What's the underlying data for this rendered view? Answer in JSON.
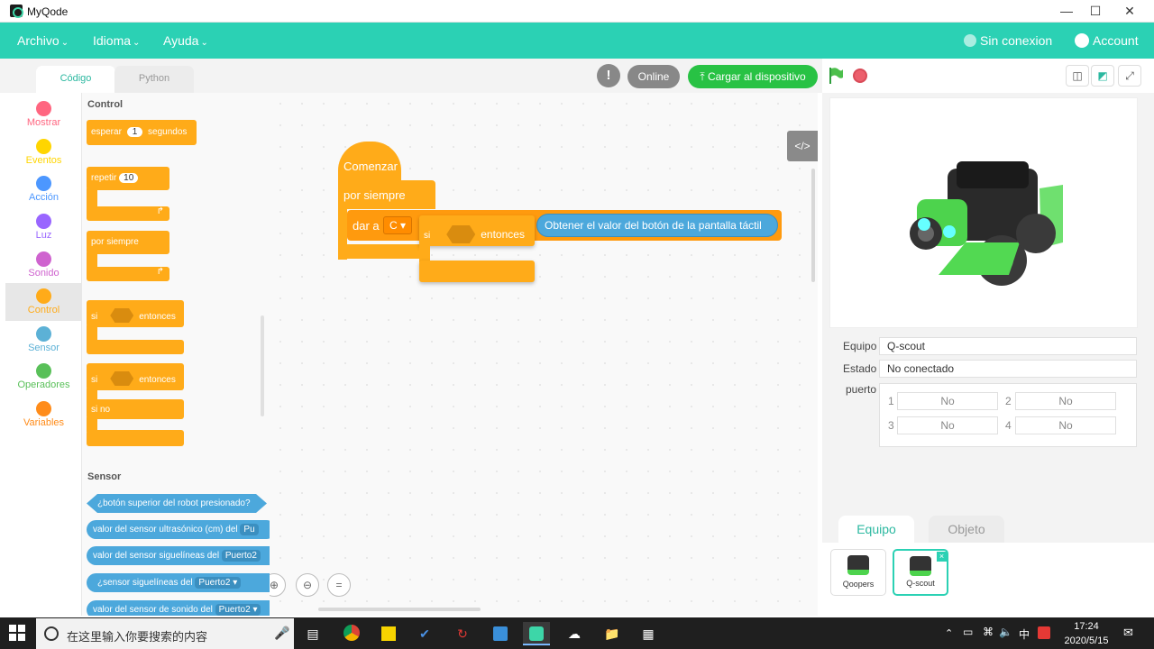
{
  "window": {
    "title": "MyQode"
  },
  "menu": {
    "archivo": "Archivo",
    "idioma": "Idioma",
    "ayuda": "Ayuda",
    "connection": "Sin conexion",
    "account": "Account"
  },
  "editor_tabs": {
    "codigo": "Código",
    "python": "Python"
  },
  "toolbar": {
    "online": "Online",
    "upload": "Cargar al dispositivo",
    "upload_icon": "⤒"
  },
  "categories": [
    {
      "label": "Mostrar",
      "color": "#ff6680"
    },
    {
      "label": "Eventos",
      "color": "#ffd500"
    },
    {
      "label": "Acción",
      "color": "#4c97ff"
    },
    {
      "label": "Luz",
      "color": "#9966ff"
    },
    {
      "label": "Sonido",
      "color": "#cf63cf"
    },
    {
      "label": "Control",
      "color": "#ffab19"
    },
    {
      "label": "Sensor",
      "color": "#5cb1d6"
    },
    {
      "label": "Operadores",
      "color": "#59c059"
    },
    {
      "label": "Variables",
      "color": "#ff8c1a"
    }
  ],
  "palette": {
    "control_heading": "Control",
    "wait": {
      "label": "esperar",
      "value": "1",
      "unit": "segundos"
    },
    "repeat": {
      "label": "repetir",
      "value": "10"
    },
    "forever": "por siempre",
    "if1": {
      "si": "si",
      "entonces": "entonces"
    },
    "if2": {
      "si": "si",
      "entonces": "entonces",
      "sino": "si no"
    },
    "sensor_heading": "Sensor",
    "sensor_blocks": [
      "¿botón superior del robot presionado?",
      "valor del sensor ultrasónico (cm) del",
      "valor del sensor siguelíneas del",
      "¿sensor siguelíneas del",
      "valor del sensor de sonido del"
    ],
    "sensor_ports": [
      "Pu",
      "Puerto2",
      "Puerto2 ▾",
      "Puerto2 ▾"
    ]
  },
  "workspace": {
    "start": "Comenzar",
    "forever": "por siempre",
    "set": "dar a",
    "var": "C ▾",
    "reporter": "Obtener el valor del botón de la pantalla táctil",
    "drag_if": {
      "si": "si",
      "entonces": "entonces"
    }
  },
  "device": {
    "equipo_label": "Equipo",
    "equipo_value": "Q-scout",
    "estado_label": "Estado",
    "estado_value": "No conectado",
    "puerto_label": "puerto",
    "ports": [
      {
        "n": "1",
        "v": "No"
      },
      {
        "n": "2",
        "v": "No"
      },
      {
        "n": "3",
        "v": "No"
      },
      {
        "n": "4",
        "v": "No"
      }
    ]
  },
  "bottom_tabs": {
    "equipo": "Equipo",
    "objeto": "Objeto"
  },
  "robots": [
    {
      "name": "Qoopers"
    },
    {
      "name": "Q-scout"
    }
  ],
  "taskbar": {
    "search": "在这里输入你要搜索的内容",
    "time": "17:24",
    "date": "2020/5/15",
    "ime": "中"
  },
  "colors": {
    "accent": "#2bd1b4",
    "control": "#ffab19",
    "sensor": "#4ca8dc",
    "upload": "#28c244"
  }
}
